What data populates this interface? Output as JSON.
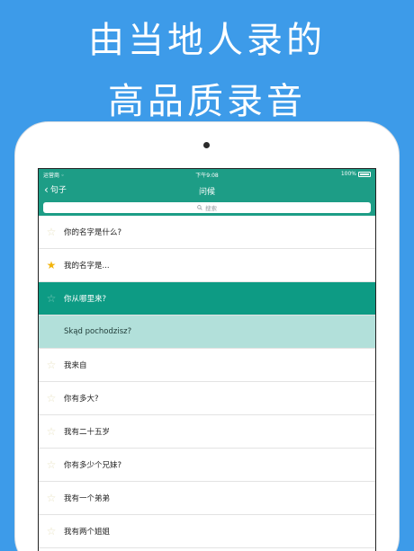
{
  "headline": {
    "line1": "由当地人录的",
    "line2": "高品质录音"
  },
  "status_bar": {
    "carrier": "运营商 ◦",
    "time": "下午9:08",
    "battery": "100%"
  },
  "nav": {
    "back_label": "句子",
    "title": "问候"
  },
  "search": {
    "placeholder": "搜索"
  },
  "rows": [
    {
      "text": "你的名字是什么?",
      "favorite": false,
      "state": "normal"
    },
    {
      "text": "我的名字是...",
      "favorite": true,
      "state": "normal"
    },
    {
      "text": "你从哪里来?",
      "favorite": false,
      "state": "selected"
    },
    {
      "text": "Skąd pochodzisz?",
      "favorite": false,
      "state": "translation"
    },
    {
      "text": "我来自",
      "favorite": false,
      "state": "normal"
    },
    {
      "text": "你有多大?",
      "favorite": false,
      "state": "normal"
    },
    {
      "text": "我有二十五岁",
      "favorite": false,
      "state": "normal"
    },
    {
      "text": "你有多少个兄妹?",
      "favorite": false,
      "state": "normal"
    },
    {
      "text": "我有一个弟弟",
      "favorite": false,
      "state": "normal"
    },
    {
      "text": "我有两个姐姐",
      "favorite": false,
      "state": "normal"
    }
  ],
  "colors": {
    "background": "#3d9be9",
    "accent": "#1d9d86",
    "selected_row": "#0d9b84",
    "translation_row": "#b2e0da",
    "favorite_star": "#f2b40c"
  },
  "icons": {
    "back": "chevron-left-icon",
    "search": "magnifier-icon",
    "row_marker": "star-icon",
    "battery": "battery-icon"
  }
}
